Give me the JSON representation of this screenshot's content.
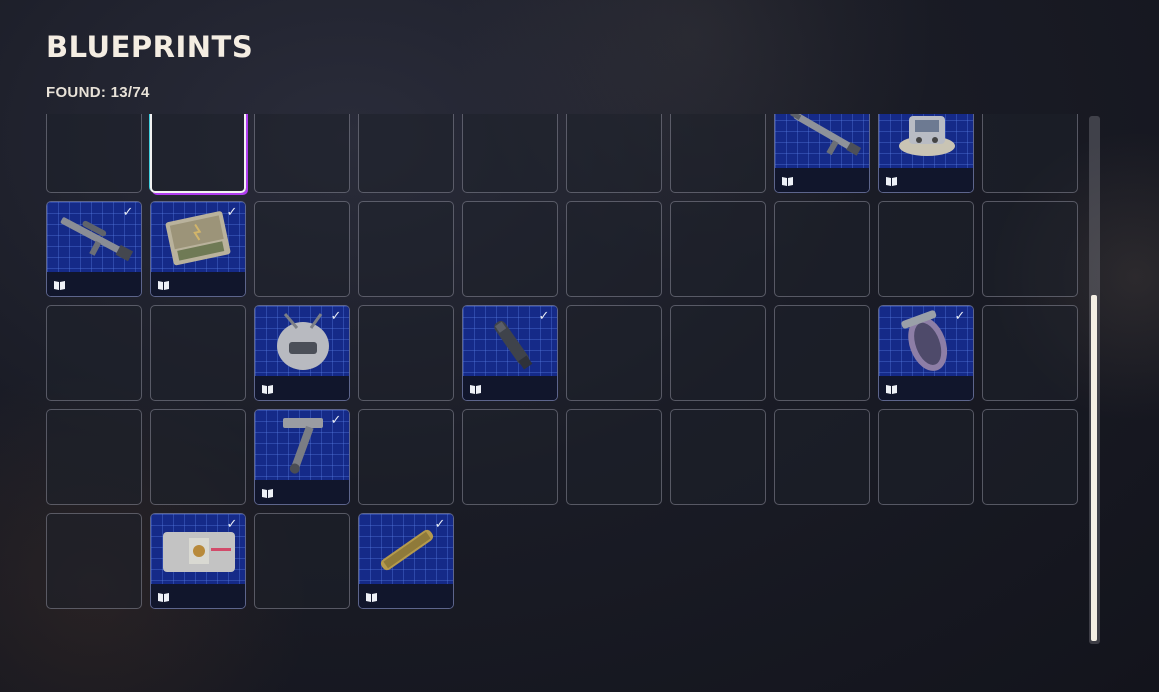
{
  "header": {
    "title": "BLUEPRINTS",
    "found_label": "FOUND: 13/74"
  },
  "grid": {
    "columns": 10,
    "rows": [
      [
        "empty",
        "empty",
        "empty",
        "empty",
        "empty",
        "empty",
        "partial",
        "empty",
        "empty",
        "empty"
      ],
      [
        "empty",
        "selected",
        "empty",
        "empty",
        "empty",
        "empty",
        "empty",
        "rifle-long",
        "drone-device",
        "empty"
      ],
      [
        "rifle-scoped",
        "case-kit",
        "empty",
        "empty",
        "empty",
        "empty",
        "empty",
        "empty",
        "empty",
        "empty"
      ],
      [
        "empty",
        "empty",
        "helmet",
        "empty",
        "barrel-part",
        "empty",
        "empty",
        "empty",
        "bracer",
        "empty"
      ],
      [
        "empty",
        "empty",
        "multitool",
        "empty",
        "empty",
        "empty",
        "empty",
        "empty",
        "empty",
        "empty"
      ],
      [
        "empty",
        "crate-box",
        "empty",
        "cylinder-tube"
      ]
    ]
  },
  "icons": {
    "found_check": "check-icon",
    "blueprint_badge": "book-icon"
  },
  "colors": {
    "blueprint_bg": "#152a88",
    "selection_outer": "#b03cf0",
    "selection_inner": "#3fd0e0",
    "scrollbar_thumb": "#f4efe4"
  },
  "scroll": {
    "position_fraction": 0.34,
    "visible_fraction": 0.66
  }
}
